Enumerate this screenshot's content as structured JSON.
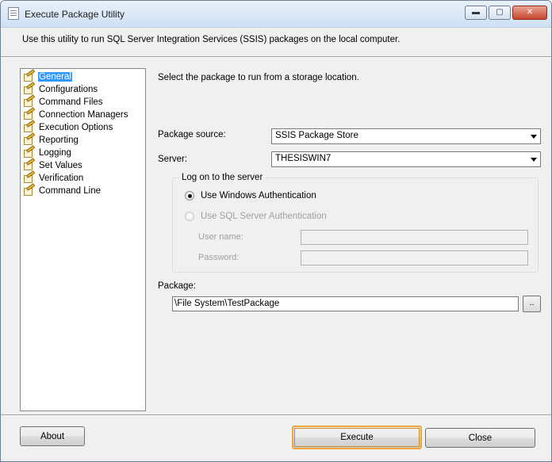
{
  "window": {
    "title": "Execute Package Utility",
    "minimize_glyph": "▬",
    "maximize_glyph": "▢",
    "close_glyph": "✕"
  },
  "intro_text": "Use this utility to run SQL Server Integration Services (SSIS) packages on the local computer.",
  "nav": {
    "selected": "General",
    "items": [
      {
        "label": "General"
      },
      {
        "label": "Configurations"
      },
      {
        "label": "Command Files"
      },
      {
        "label": "Connection Managers"
      },
      {
        "label": "Execution Options"
      },
      {
        "label": "Reporting"
      },
      {
        "label": "Logging"
      },
      {
        "label": "Set Values"
      },
      {
        "label": "Verification"
      },
      {
        "label": "Command Line"
      }
    ]
  },
  "general": {
    "description": "Select the package to run from a storage location.",
    "package_source_label": "Package source:",
    "package_source_value": "SSIS Package Store",
    "server_label": "Server:",
    "server_value": "THESISWIN7",
    "logon_group_title": "Log on to the server",
    "windows_auth_label": "Use Windows Authentication",
    "sql_auth_label": "Use SQL Server Authentication",
    "user_name_label": "User name:",
    "password_label": "Password:",
    "package_label": "Package:",
    "package_value": "\\File System\\TestPackage",
    "browse_label": ".."
  },
  "buttons": {
    "about": "About",
    "execute": "Execute",
    "close": "Close"
  }
}
